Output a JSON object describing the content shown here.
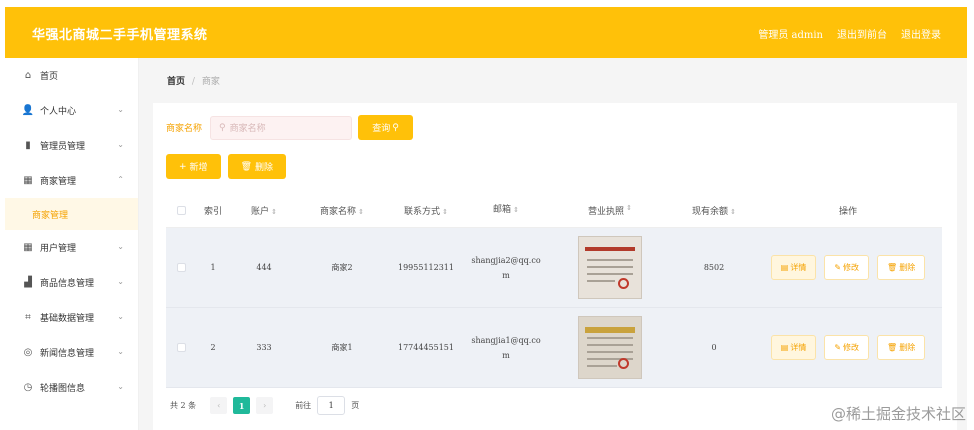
{
  "header": {
    "title": "华强北商城二手手机管理系统",
    "admin": "管理员 admin",
    "back_to_front": "退出到前台",
    "logout": "退出登录",
    "bg_color": "#ffc109"
  },
  "sidebar": {
    "items": [
      {
        "label": "首页",
        "icon": "home-icon"
      },
      {
        "label": "个人中心",
        "icon": "user-icon"
      },
      {
        "label": "管理员管理",
        "icon": "chart-bars-icon"
      },
      {
        "label": "商家管理",
        "icon": "grid-icon",
        "expanded": true
      },
      {
        "label": "商家管理",
        "icon": "",
        "sub": true,
        "active": true
      },
      {
        "label": "用户管理",
        "icon": "table-grid-icon"
      },
      {
        "label": "商品信息管理",
        "icon": "bar-chart-icon"
      },
      {
        "label": "基础数据管理",
        "icon": "crop-icon"
      },
      {
        "label": "新闻信息管理",
        "icon": "compass-icon"
      },
      {
        "label": "轮播图信息",
        "icon": "clock-icon"
      }
    ]
  },
  "breadcrumb": {
    "home": "首页",
    "separator": "/",
    "current": "商家"
  },
  "search": {
    "label": "商家名称",
    "placeholder": "商家名称",
    "button": "查询"
  },
  "actions": {
    "add": "新增",
    "delete": "删除"
  },
  "table": {
    "headers": {
      "index": "索引",
      "account": "账户",
      "name": "商家名称",
      "phone": "联系方式",
      "email": "邮箱",
      "license": "营业执照",
      "balance": "现有余额",
      "ops": "操作"
    },
    "rows": [
      {
        "index": "1",
        "account": "444",
        "name": "商家2",
        "phone": "19955112311",
        "email": "shangjia2@qq.com",
        "balance": "8502"
      },
      {
        "index": "2",
        "account": "333",
        "name": "商家1",
        "phone": "17744455151",
        "email": "shangjia1@qq.com",
        "balance": "0"
      }
    ],
    "op_labels": {
      "detail": "详情",
      "edit": "修改",
      "delete": "删除"
    }
  },
  "pagination": {
    "total": "共 2 条",
    "current_page": "1",
    "jump_prefix": "前往",
    "jump_value": "1",
    "jump_suffix": "页"
  },
  "watermark": "@稀土掘金技术社区"
}
